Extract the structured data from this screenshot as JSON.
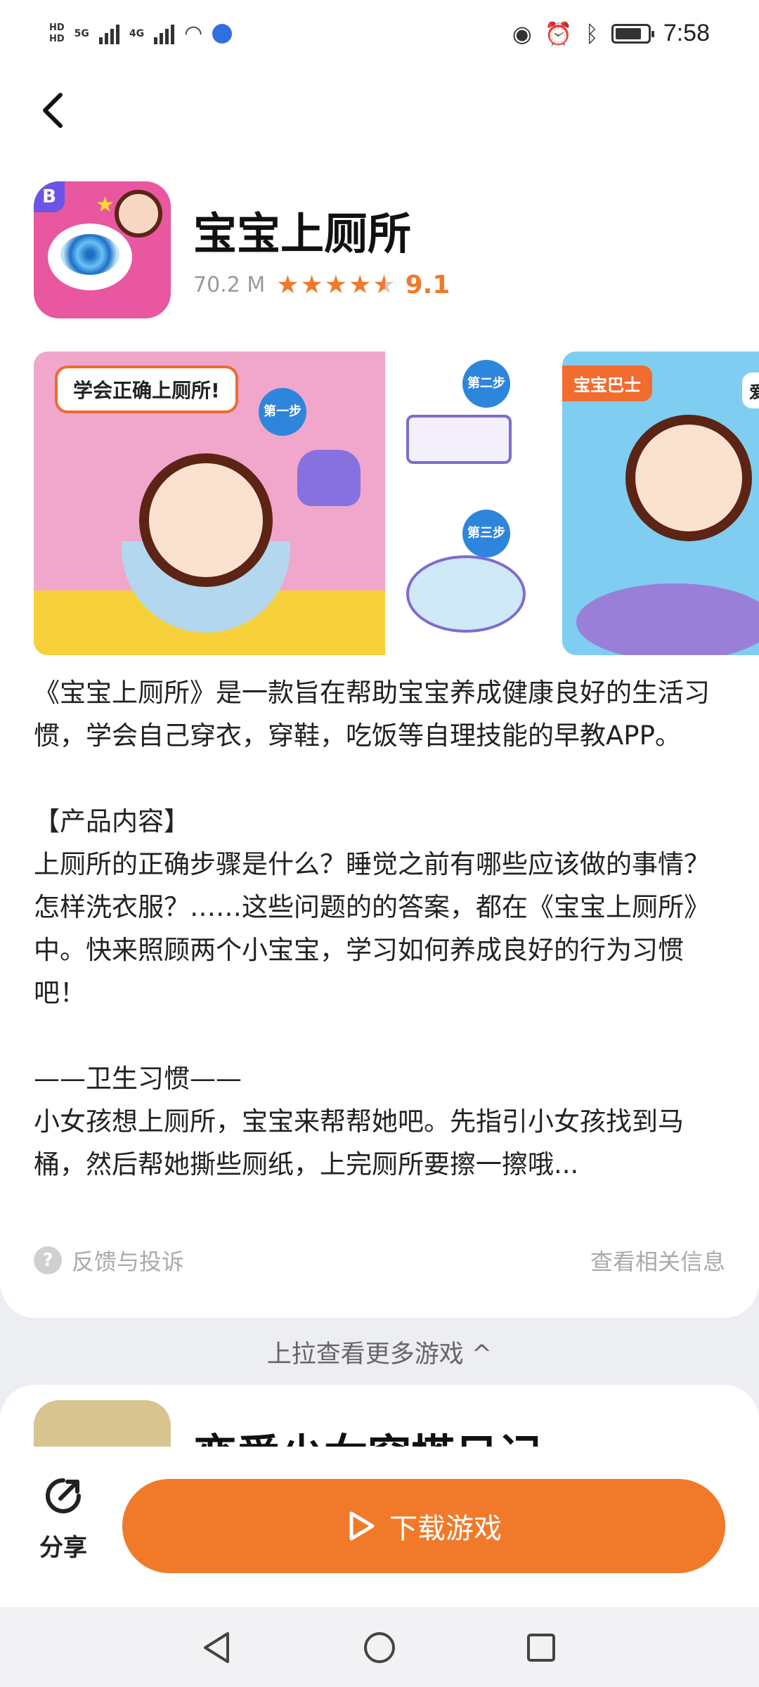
{
  "status_bar": {
    "network_1": "5G",
    "network_2": "4G",
    "time": "7:58"
  },
  "app": {
    "title": "宝宝上厕所",
    "size": "70.2 M",
    "rating": "9.1",
    "rating_value": 4.5
  },
  "screenshots": {
    "shot1_banner": "学会正确上厕所!",
    "step1": "第一步",
    "step2": "第二步",
    "step3": "第三步",
    "shot2_logo": "宝宝巴士",
    "shot2_text": "爱"
  },
  "description": {
    "p1": "《宝宝上厕所》是一款旨在帮助宝宝养成健康良好的生活习惯，学会自己穿衣，穿鞋，吃饭等自理技能的早教APP。",
    "section_title": "【产品内容】",
    "p2": "上厕所的正确步骤是什么？睡觉之前有哪些应该做的事情？怎样洗衣服？……这些问题的的答案，都在《宝宝上厕所》中。快来照顾两个小宝宝，学习如何养成良好的行为习惯吧！",
    "sub_title": "——卫生习惯——",
    "p3": "小女孩想上厕所，宝宝来帮帮她吧。先指引小女孩找到马桶，然后帮她撕些厕纸，上完厕所要擦一擦哦..."
  },
  "feedback": {
    "label": "反馈与投诉",
    "related": "查看相关信息"
  },
  "pull_up": "上拉查看更多游戏 ^",
  "next_game": {
    "title": "恋爱少女穿搭日记"
  },
  "actions": {
    "share": "分享",
    "download": "下载游戏"
  },
  "colors": {
    "accent": "#f07a2a"
  }
}
